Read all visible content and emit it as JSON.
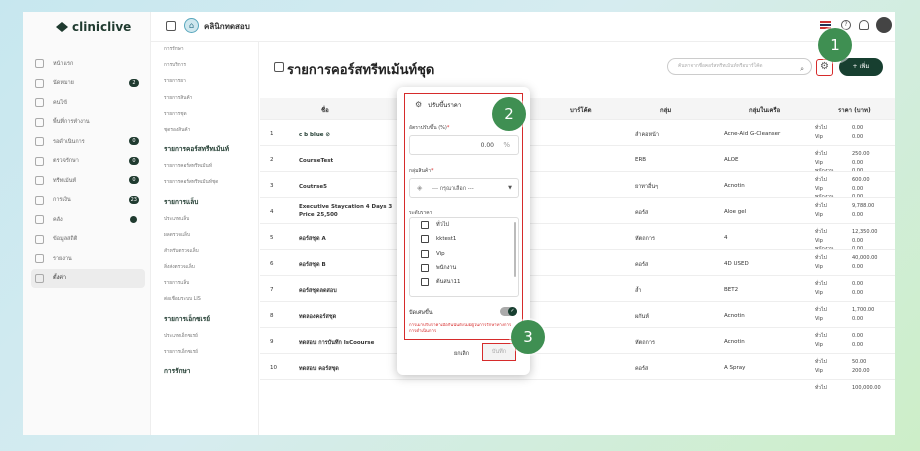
{
  "brand": {
    "name": "cliniclive"
  },
  "topbar": {
    "clinic_name": "คลินิกทดสอบ"
  },
  "nav": [
    {
      "label": "หน้าแรก",
      "badge": ""
    },
    {
      "label": "นัดหมาย",
      "badge": "2"
    },
    {
      "label": "คนไข้",
      "badge": ""
    },
    {
      "label": "พื้นที่การทำงาน",
      "badge": ""
    },
    {
      "label": "รอดำเนินการ",
      "badge": "0"
    },
    {
      "label": "ตรวจรักษา",
      "badge": "0"
    },
    {
      "label": "ทรีทเม้นท์",
      "badge": "0"
    },
    {
      "label": "การเงิน",
      "badge": "23"
    },
    {
      "label": "คลัง",
      "badge": "dot"
    },
    {
      "label": "ข้อมูลสถิติ",
      "badge": ""
    },
    {
      "label": "รายงาน",
      "badge": ""
    },
    {
      "label": "ตั้งค่า",
      "badge": ""
    }
  ],
  "submenu": [
    {
      "label": "การรักษา",
      "type": "item"
    },
    {
      "label": "การบริการ",
      "type": "item"
    },
    {
      "label": "รายการยา",
      "type": "item"
    },
    {
      "label": "รายการสินค้า",
      "type": "item"
    },
    {
      "label": "รายการชุด",
      "type": "item"
    },
    {
      "label": "ชุดรองสินค้า",
      "type": "item"
    },
    {
      "label": "รายการคอร์สทรีทเม้นท์",
      "type": "head"
    },
    {
      "label": "รายการคอร์สทรีทเม้นท์",
      "type": "item"
    },
    {
      "label": "รายการคอร์สทรีทเม้นท์ชุด",
      "type": "item"
    },
    {
      "label": "รายการแล็บ",
      "type": "head"
    },
    {
      "label": "ประเภทแล็บ",
      "type": "item"
    },
    {
      "label": "ผลตรวจแล็บ",
      "type": "item"
    },
    {
      "label": "สำหรับตรวจแล็บ",
      "type": "item"
    },
    {
      "label": "สิ่งส่งตรวจแล็บ",
      "type": "item"
    },
    {
      "label": "รายการแล็บ",
      "type": "item"
    },
    {
      "label": "ต่อเชื่อมระบบ LIS",
      "type": "item"
    },
    {
      "label": "รายการเอ็กซเรย์",
      "type": "head"
    },
    {
      "label": "ประเภทเอ็กซเรย์",
      "type": "item"
    },
    {
      "label": "รายการเอ็กซเรย์",
      "type": "item"
    },
    {
      "label": "การรักษา",
      "type": "head"
    }
  ],
  "page": {
    "title": "รายการคอร์สทรีทเม้นท์ชุด",
    "search_placeholder": "ค้นหาจากชื่อคอร์สทรีทเม้นท์หรือบาร์โค้ด",
    "add_label": "+ เพิ่ม"
  },
  "table": {
    "headers": [
      "ชื่อ",
      "บาร์โค้ด",
      "กลุ่ม",
      "กลุ่มในเครือ",
      "ราคา (บาท)"
    ],
    "rows": [
      {
        "no": "1",
        "name": "c b blue ⊘",
        "group": "ลำคอหน้า",
        "sub": "Acne-Aid G-Cleanser",
        "labels": "ทั่วไป\nVip",
        "prices": "0.00\n0.00"
      },
      {
        "no": "2",
        "name": "CourseTest",
        "group": "ERB",
        "sub": "ALOE",
        "labels": "ทั่วไป\nVip\nพนักงาน",
        "prices": "250.00\n0.00\n0.00"
      },
      {
        "no": "3",
        "name": "Coutrse5",
        "group": "ยาทาอื่นๆ",
        "sub": "Acnotin",
        "labels": "ทั่วไป\nVip\nพนักงาน",
        "prices": "600.00\n0.00\n0.00"
      },
      {
        "no": "4",
        "name": "Executive Staycation 4 Days 3\nPrice 25,500",
        "group": "คอร์ส",
        "sub": "Aloe gel",
        "labels": "ทั่วไป\nVip",
        "prices": "9,788.00\n0.00"
      },
      {
        "no": "5",
        "name": "คอร์สชุด A",
        "group": "หัตถการ",
        "sub": "4",
        "labels": "ทั่วไป\nVip\nพนักงาน",
        "prices": "12,350.00\n0.00\n0.00"
      },
      {
        "no": "6",
        "name": "คอร์สชุด B",
        "group": "คอร์ส",
        "sub": "4D USED",
        "labels": "ทั่วไป\nVip",
        "prices": "40,000.00\n0.00"
      },
      {
        "no": "7",
        "name": "คอร์สชุดลดสอบ",
        "group": "ล้ำ",
        "sub": "BET2",
        "labels": "ทั่วไป\nVip",
        "prices": "0.00\n0.00"
      },
      {
        "no": "8",
        "name": "ทดลองคอร์สชุด",
        "group": "ผกันห์",
        "sub": "Acnotin",
        "labels": "ทั่วไป\nVip",
        "prices": "1,700.00\n0.00"
      },
      {
        "no": "9",
        "name": "ทดสอบ การบันทึก IsCoourse",
        "group": "หัตถการ",
        "sub": "Acnotin",
        "labels": "ทั่วไป\nVip",
        "prices": "0.00\n0.00"
      },
      {
        "no": "10",
        "name": "ทดสอบ คอร์สชุด",
        "group": "คอร์ส",
        "sub": "A Spray",
        "labels": "ทั่วไป\nVip",
        "prices": "50.00\n200.00"
      },
      {
        "no": "",
        "name": "",
        "group": "",
        "sub": "",
        "labels": "ทั่วไป",
        "prices": "100,000.00"
      }
    ]
  },
  "modal": {
    "title": "ปรับขึ้นราคา",
    "rate_label": "อัตราปรับขึ้น (%)",
    "rate_value": "0.00",
    "rate_unit": "%",
    "group_label": "กลุ่มสินค้า",
    "group_value": "--- กรุณาเลือก ---",
    "level_label": "ระดับราคา",
    "levels": [
      "ทั่วไป",
      "kktest1",
      "Vip",
      "พนักงาน",
      "ต้นสนา11"
    ],
    "round_label": "ปัดเศษขึ้น",
    "warning": "การเมาปรับราคาเมื่อกันนั้นยังไม่มีผู้ในการรักษาทางการ การดำเนินการ",
    "cancel_label": "ยกเลิก",
    "save_label": "บันทึก"
  },
  "steps": [
    "1",
    "2",
    "3"
  ],
  "colors": {
    "brand_green": "#173f30",
    "step_green": "#3f8f52",
    "highlight_red": "#d62b2b"
  }
}
